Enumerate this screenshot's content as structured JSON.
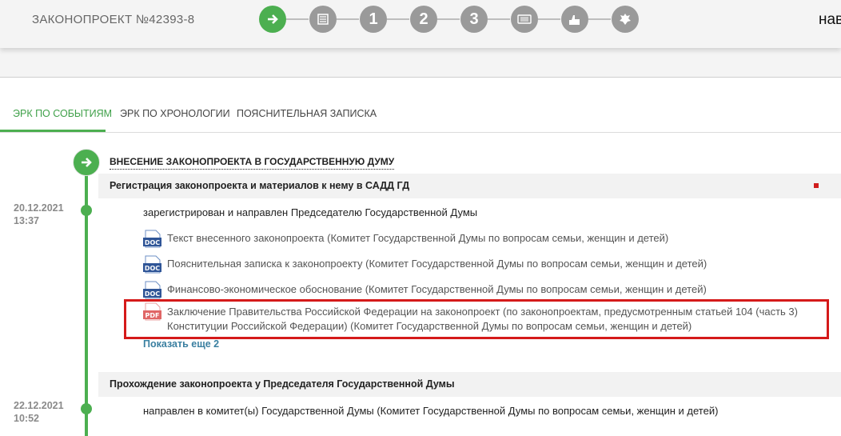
{
  "header": {
    "bill_title": "ЗАКОНОПРОЕКТ №42393-8",
    "stages": [
      {
        "icon": "arrow-right-icon",
        "active": true
      },
      {
        "icon": "document-list-icon",
        "active": false
      },
      {
        "label": "1",
        "active": false
      },
      {
        "label": "2",
        "active": false
      },
      {
        "label": "3",
        "active": false
      },
      {
        "icon": "council-icon",
        "active": false
      },
      {
        "icon": "hand-icon",
        "active": false
      },
      {
        "icon": "emblem-icon",
        "active": false
      }
    ],
    "right_text": "нав"
  },
  "tabs": [
    {
      "label": "ЭРК ПО СОБЫТИЯМ",
      "active": true
    },
    {
      "label": "ЭРК ПО ХРОНОЛОГИИ",
      "active": false
    },
    {
      "label": "ПОЯСНИТЕЛЬНАЯ ЗАПИСКА",
      "active": false
    }
  ],
  "timeline": {
    "event_title": "ВНЕСЕНИЕ ЗАКОНОПРОЕКТА В ГОСУДАРСТВЕННУЮ ДУМУ",
    "stage1": {
      "title": "Регистрация законопроекта и материалов к нему в САДД ГД",
      "date": "20.12.2021",
      "time": "13:37",
      "action": "зарегистрирован и направлен Председателю Государственной Думы",
      "documents": [
        {
          "type": "DOC",
          "text": "Текст внесенного законопроекта (Комитет Государственной Думы по вопросам семьи, женщин и детей)"
        },
        {
          "type": "DOC",
          "text": "Пояснительная записка к законопроекту (Комитет Государственной Думы по вопросам семьи, женщин и детей)"
        },
        {
          "type": "DOC",
          "text": "Финансово-экономическое обоснование (Комитет Государственной Думы по вопросам семьи, женщин и детей)"
        },
        {
          "type": "PDF",
          "line1": "Заключение Правительства Российской Федерации на законопроект (по законопроектам, предусмотренным статьей 104 (часть 3)",
          "line2": "Конституции Российской Федерации) (Комитет Государственной Думы по вопросам семьи, женщин и детей)"
        }
      ],
      "show_more": "Показать еще 2"
    },
    "stage2": {
      "title": "Прохождение законопроекта у Председателя Государственной Думы",
      "date": "22.12.2021",
      "time": "10:52",
      "action": "направлен в комитет(ы) Государственной Думы (Комитет Государственной Думы по вопросам семьи, женщин и детей)"
    }
  },
  "colors": {
    "accent_green": "#4caf50",
    "highlight_red": "#d51a1a",
    "doc_icon_blue": "#2f5597",
    "pdf_icon_red": "#e06666",
    "link_blue": "#3a7fa0"
  }
}
